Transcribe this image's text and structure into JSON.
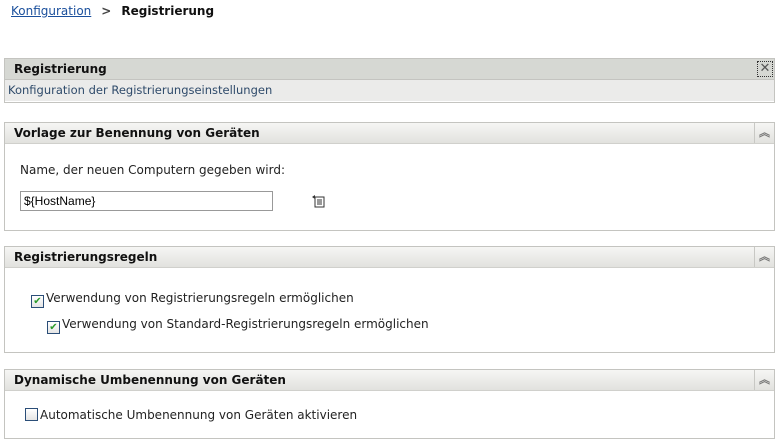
{
  "breadcrumb": {
    "parent": "Konfiguration",
    "separator": ">",
    "current": "Registrierung"
  },
  "main_panel": {
    "title": "Registrierung",
    "description": "Konfiguration der Registrierungseinstellungen"
  },
  "naming": {
    "title": "Vorlage zur Benennung von Geräten",
    "label": "Name, der neuen Computern gegeben wird:",
    "value": "${HostName}"
  },
  "rules": {
    "title": "Registrierungsregeln",
    "items": [
      {
        "label": "Verwendung von Registrierungsregeln ermöglichen",
        "checked": true
      },
      {
        "label": "Verwendung von Standard-Registrierungsregeln ermöglichen",
        "checked": true
      }
    ]
  },
  "rename": {
    "title": "Dynamische Umbenennung von Geräten",
    "items": [
      {
        "label": "Automatische Umbenennung von Geräten aktivieren",
        "checked": false
      }
    ]
  },
  "icons": {
    "collapse": "⌃⌃",
    "close": "✕",
    "check": "✔"
  }
}
